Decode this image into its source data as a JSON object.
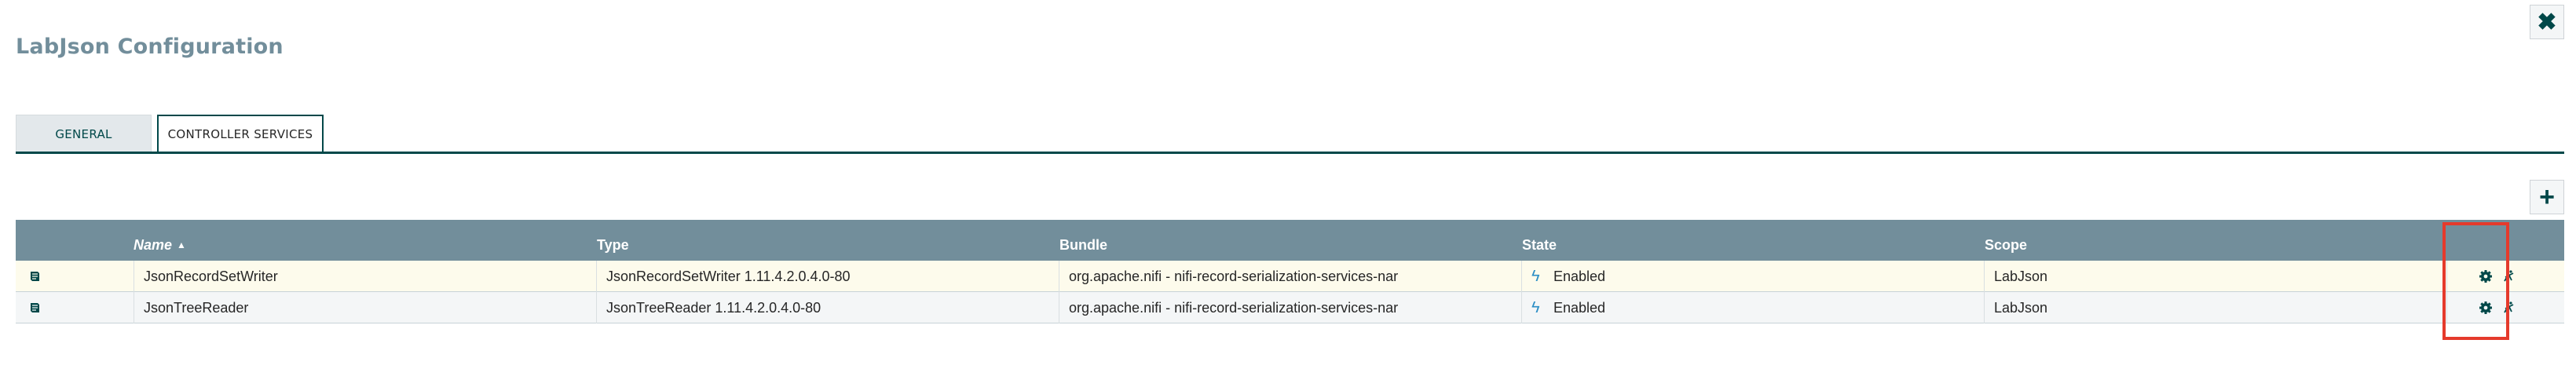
{
  "dialog": {
    "title": "LabJson Configuration",
    "close_icon": "close-icon"
  },
  "tabs": [
    {
      "label": "GENERAL",
      "active": false
    },
    {
      "label": "CONTROLLER SERVICES",
      "active": true
    }
  ],
  "toolbar": {
    "add_icon": "plus-icon"
  },
  "table": {
    "columns": [
      "Name",
      "Type",
      "Bundle",
      "State",
      "Scope"
    ],
    "sort": {
      "column": "Name",
      "direction": "ascending"
    },
    "rows": [
      {
        "name": "JsonRecordSetWriter",
        "type": "JsonRecordSetWriter 1.11.4.2.0.4.0-80",
        "bundle": "org.apache.nifi - nifi-record-serialization-services-nar",
        "state": "Enabled",
        "scope": "LabJson"
      },
      {
        "name": "JsonTreeReader",
        "type": "JsonTreeReader 1.11.4.2.0.4.0-80",
        "bundle": "org.apache.nifi - nifi-record-serialization-services-nar",
        "state": "Enabled",
        "scope": "LabJson"
      }
    ]
  },
  "colors": {
    "accent": "#004849",
    "header_bg": "#728e9b",
    "enabled_icon": "#2b8ec5",
    "highlight_box": "#e53a2c"
  }
}
